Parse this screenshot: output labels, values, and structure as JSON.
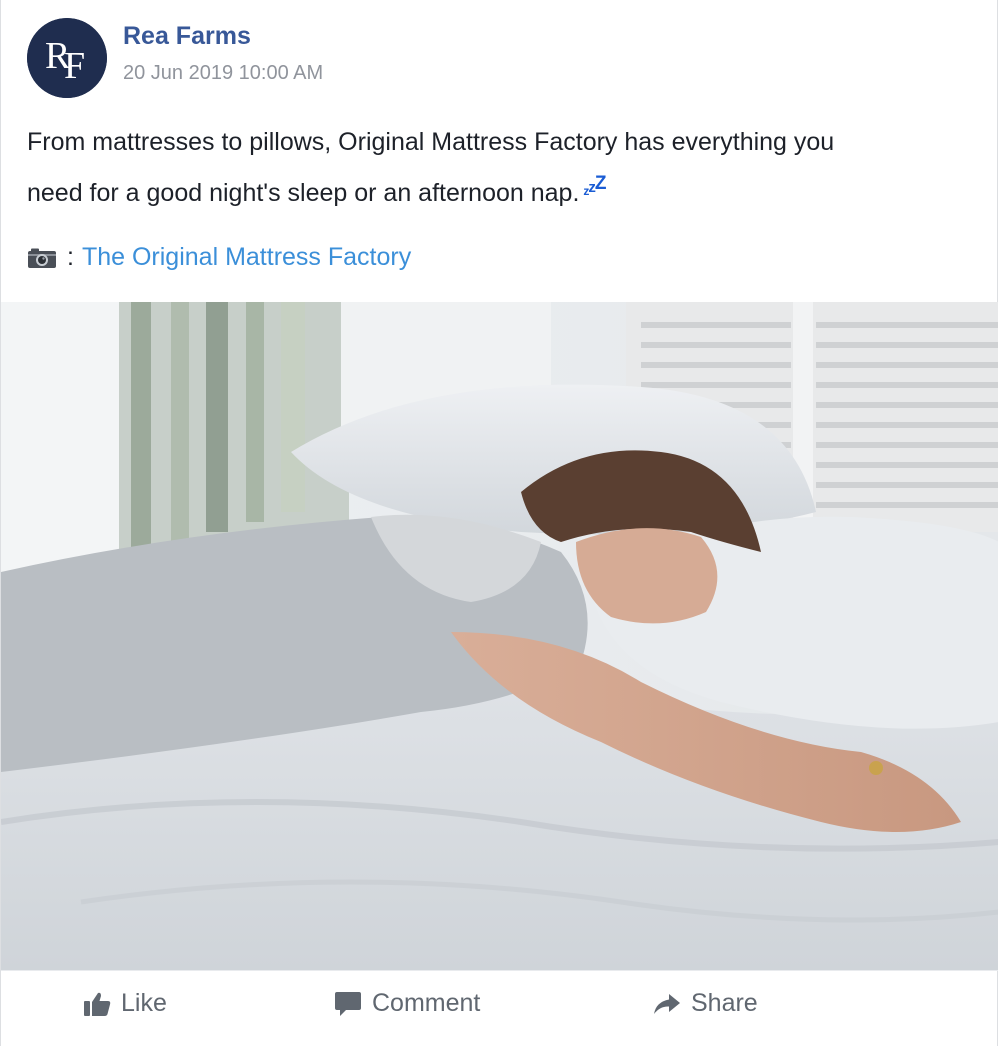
{
  "post": {
    "author": "Rea Farms",
    "avatar_text": "RF",
    "timestamp": "20 Jun 2019 10:00 AM",
    "text_line1": "From mattresses to pillows, Original Mattress Factory has everything you",
    "text_line2": "need for a good night's sleep or an afternoon nap.",
    "emoji_zzz": "zzZ",
    "credit_separator": ":",
    "credit_link": "The Original Mattress Factory",
    "camera_icon": "camera-icon",
    "image_alt_subject": "woman sleeping face-down on a bed with white pillows"
  },
  "actions": {
    "like_label": "Like",
    "comment_label": "Comment",
    "share_label": "Share"
  },
  "colors": {
    "author": "#385898",
    "link": "#3b8fd9",
    "muted": "#90949c",
    "action": "#606770",
    "avatar_bg": "#1f2d4f"
  }
}
